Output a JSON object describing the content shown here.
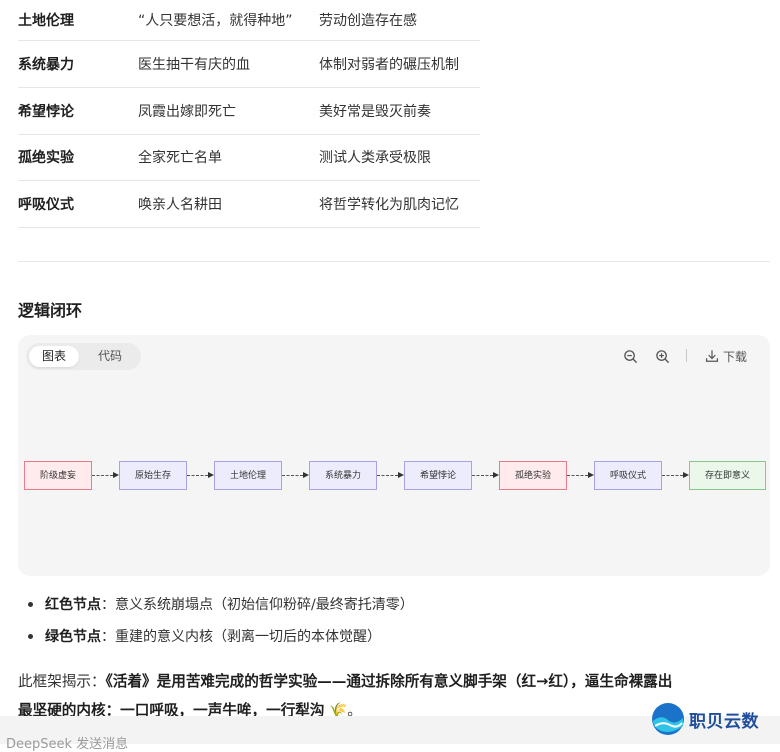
{
  "table": {
    "rows": [
      {
        "col1": "土地伦理",
        "col2": "“人只要想活，就得种地”",
        "col3": "劳动创造存在感"
      },
      {
        "col1": "系统暴力",
        "col2": "医生抽干有庆的血",
        "col3": "体制对弱者的碾压机制"
      },
      {
        "col1": "希望悖论",
        "col2": "凤霞出嫁即死亡",
        "col3": "美好常是毁灭前奏"
      },
      {
        "col1": "孤绝实验",
        "col2": "全家死亡名单",
        "col3": "测试人类承受极限"
      },
      {
        "col1": "呼吸仪式",
        "col2": "唤亲人名耕田",
        "col3": "将哲学转化为肌肉记忆"
      }
    ]
  },
  "section_title": "逻辑闭环",
  "diagram_card": {
    "tabs": [
      "图表",
      "代码"
    ],
    "download_label": "下载",
    "icons": {
      "zoom_out": "zoom-out-icon",
      "zoom_in": "zoom-in-icon",
      "download": "download-icon"
    }
  },
  "flow": {
    "nodes": [
      {
        "label": "阶级虚妄",
        "kind": "red"
      },
      {
        "label": "原始生存",
        "kind": "blue"
      },
      {
        "label": "土地伦理",
        "kind": "blue"
      },
      {
        "label": "系统暴力",
        "kind": "blue"
      },
      {
        "label": "希望悖论",
        "kind": "blue"
      },
      {
        "label": "孤绝实验",
        "kind": "red"
      },
      {
        "label": "呼吸仪式",
        "kind": "blue"
      },
      {
        "label": "存在即意义",
        "kind": "green"
      }
    ],
    "colors": {
      "red_border": "#e87b87",
      "blue_border": "#a7a3e6",
      "green_border": "#86c98a"
    }
  },
  "bullets": [
    {
      "title": "红色节点",
      "text": "：意义系统崩塌点（初始信仰粉碎/最终寄托清零）"
    },
    {
      "title": "绿色节点",
      "text": "：重建的意义内核（剥离一切后的本体觉醒）"
    }
  ],
  "paragraph": {
    "prefix": "此框架揭示：",
    "bold1": "《活着》是用苦难完成的哲学实验——通过拆除所有意义脚手架（红→红），逼生命裸露出",
    "bold2": "最坚硬的内核：一口呼吸，一声牛哞，一行犁沟",
    "suffix": "。",
    "emoji": "🌾"
  },
  "input": {
    "placeholder": "DeepSeek 发送消息"
  },
  "watermark": {
    "text": "职贝云数",
    "color": "#1f4e9c"
  }
}
